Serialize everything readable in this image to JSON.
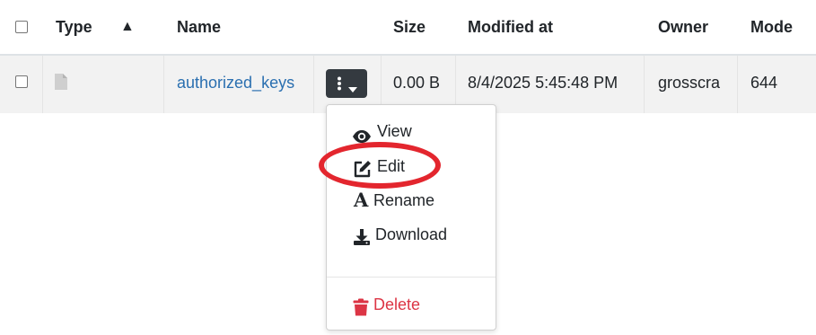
{
  "table": {
    "headers": {
      "type": "Type",
      "sort_indicator": "▲",
      "name": "Name",
      "size": "Size",
      "modified": "Modified at",
      "owner": "Owner",
      "mode": "Mode"
    },
    "rows": [
      {
        "type_icon": "file-icon",
        "name": "authorized_keys",
        "size": "0.00 B",
        "modified": "8/4/2025 5:45:48 PM",
        "owner": "grosscra",
        "mode": "644"
      }
    ]
  },
  "row_actions_menu": {
    "items": [
      {
        "label": "View",
        "icon": "eye-icon"
      },
      {
        "label": "Edit",
        "icon": "edit-icon"
      },
      {
        "label": "Rename",
        "icon": "font-a-icon"
      },
      {
        "label": "Download",
        "icon": "download-icon"
      },
      {
        "label": "Delete",
        "icon": "trash-icon"
      }
    ]
  },
  "colors": {
    "link": "#2a6fb0",
    "button_dark": "#343a40",
    "delete": "#dc3545",
    "annotation": "#e3262e",
    "row_bg": "#f2f2f2"
  }
}
